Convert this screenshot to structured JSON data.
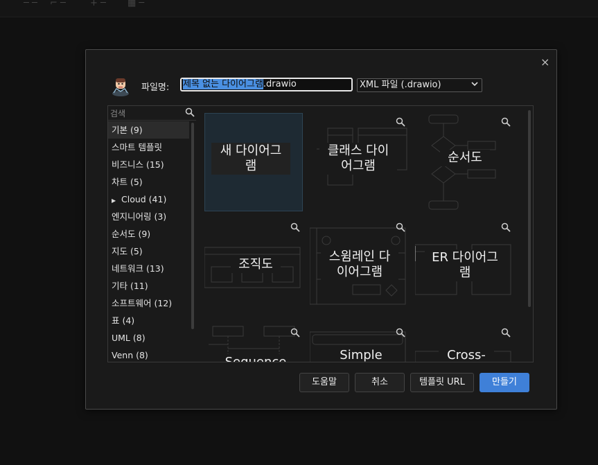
{
  "dialog": {
    "filename_label": "파일명:",
    "filename_selected": "제목 없는 다이어그램",
    "filename_ext": ".drawio",
    "format": "XML 파일 (.drawio)",
    "close_symbol": "×"
  },
  "search": {
    "placeholder": "검색"
  },
  "categories": [
    {
      "label": "기본 (9)",
      "active": true
    },
    {
      "label": "스마트 템플릿"
    },
    {
      "label": "비즈니스 (15)"
    },
    {
      "label": "차트 (5)"
    },
    {
      "label": "Cloud (41)",
      "arrow": "▶"
    },
    {
      "label": "엔지니어링 (3)"
    },
    {
      "label": "순서도 (9)"
    },
    {
      "label": "지도 (5)"
    },
    {
      "label": "네트워크 (13)"
    },
    {
      "label": "기타 (11)"
    },
    {
      "label": "소프트웨어 (12)"
    },
    {
      "label": "표 (4)"
    },
    {
      "label": "UML (8)"
    },
    {
      "label": "Venn (8)"
    }
  ],
  "templates": [
    {
      "line1": "새 다이어그",
      "line2": "램"
    },
    {
      "line1": "클래스 다이",
      "line2": "어그램"
    },
    {
      "line1": "순서도",
      "line2": ""
    },
    {
      "line1": "조직도",
      "line2": ""
    },
    {
      "line1": "스윔레인 다",
      "line2": "이어그램"
    },
    {
      "line1": "ER 다이어그",
      "line2": "램"
    },
    {
      "line1": "Sequence",
      "line2": ""
    },
    {
      "line1": "Simple",
      "line2": ""
    },
    {
      "line1": "Cross-",
      "line2": ""
    }
  ],
  "buttons": {
    "help": "도움말",
    "cancel": "취소",
    "template_url": "템플릿 URL",
    "create": "만들기"
  }
}
